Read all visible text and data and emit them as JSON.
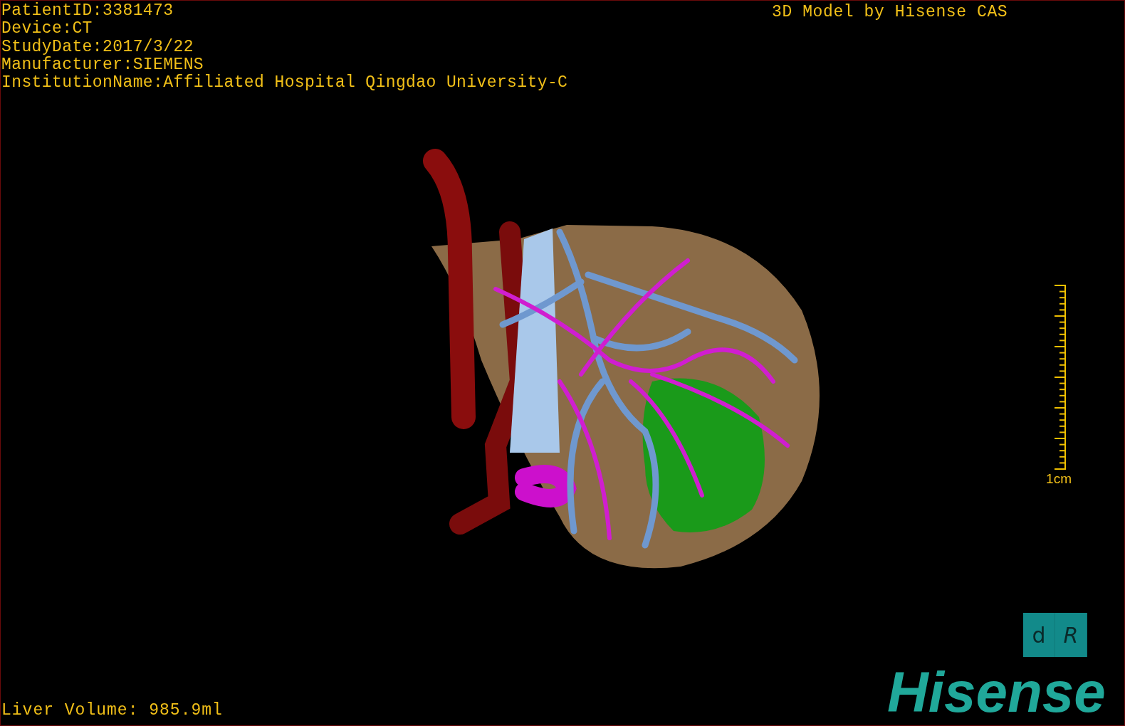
{
  "info_lines": [
    "PatientID:3381473",
    "Device:CT",
    "StudyDate:2017/3/22",
    "Manufacturer:SIEMENS",
    "InstitutionName:Affiliated Hospital Qingdao University-C"
  ],
  "title": "3D Model by Hisense CAS",
  "scale_bar": {
    "label": "1cm"
  },
  "orientation_cube": {
    "faces": [
      "d",
      "R"
    ]
  },
  "logo": "Hisense",
  "liver_volume": "Liver Volume: 985.9ml"
}
